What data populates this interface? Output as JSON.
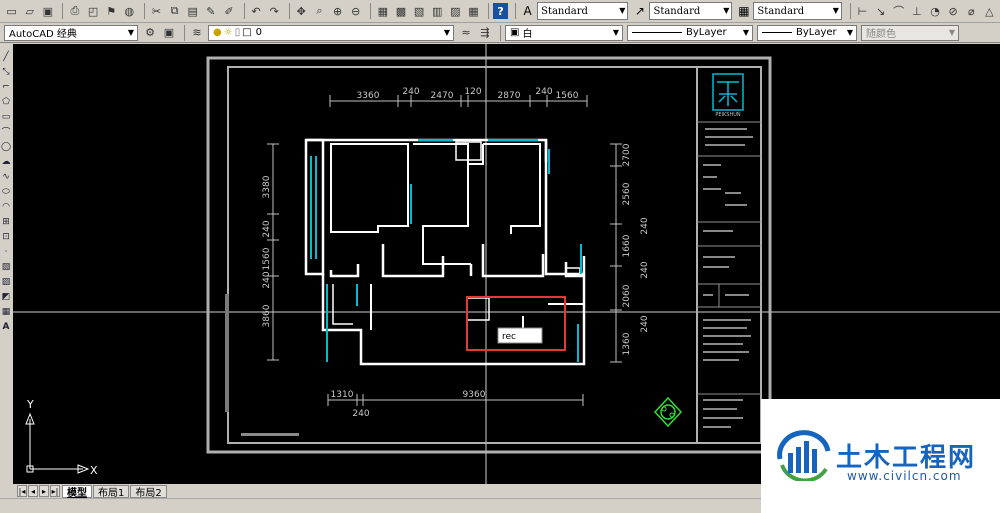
{
  "toolbar_top": {
    "text_style": "Standard",
    "dim_style": "Standard",
    "table_style": "Standard"
  },
  "toolbar_layers": {
    "workspace": "AutoCAD 经典",
    "layer": "0",
    "color": "白",
    "linetype": "ByLayer",
    "lineweight": "ByLayer",
    "plot_style": "随颜色"
  },
  "drawing": {
    "dims_top": [
      "3360",
      "240",
      "2470",
      "120",
      "2870",
      "240",
      "1560"
    ],
    "dims_left": [
      "3380",
      "240",
      "1560",
      "240",
      "3860"
    ],
    "dims_right": [
      "2700",
      "2560",
      "240",
      "1660",
      "240",
      "2060",
      "240",
      "1360"
    ],
    "dim_bottom_left": "1310",
    "dim_bottom_mid": "9360",
    "dim_bottom_240": "240",
    "title_block_brand": "PEIKSHUN",
    "command_tooltip": "rec",
    "ucs_x": "X",
    "ucs_y": "Y"
  },
  "tabs": {
    "model": "模型",
    "layout1": "布局1",
    "layout2": "布局2"
  },
  "watermark": {
    "title": "土木工程网",
    "url": "www.civilcn.com"
  },
  "colors": {
    "canvas_bg": "#000000",
    "wall": "#ffffff",
    "window": "#00bcd4",
    "highlight": "#e53935",
    "brand_blue": "#1565c0"
  }
}
